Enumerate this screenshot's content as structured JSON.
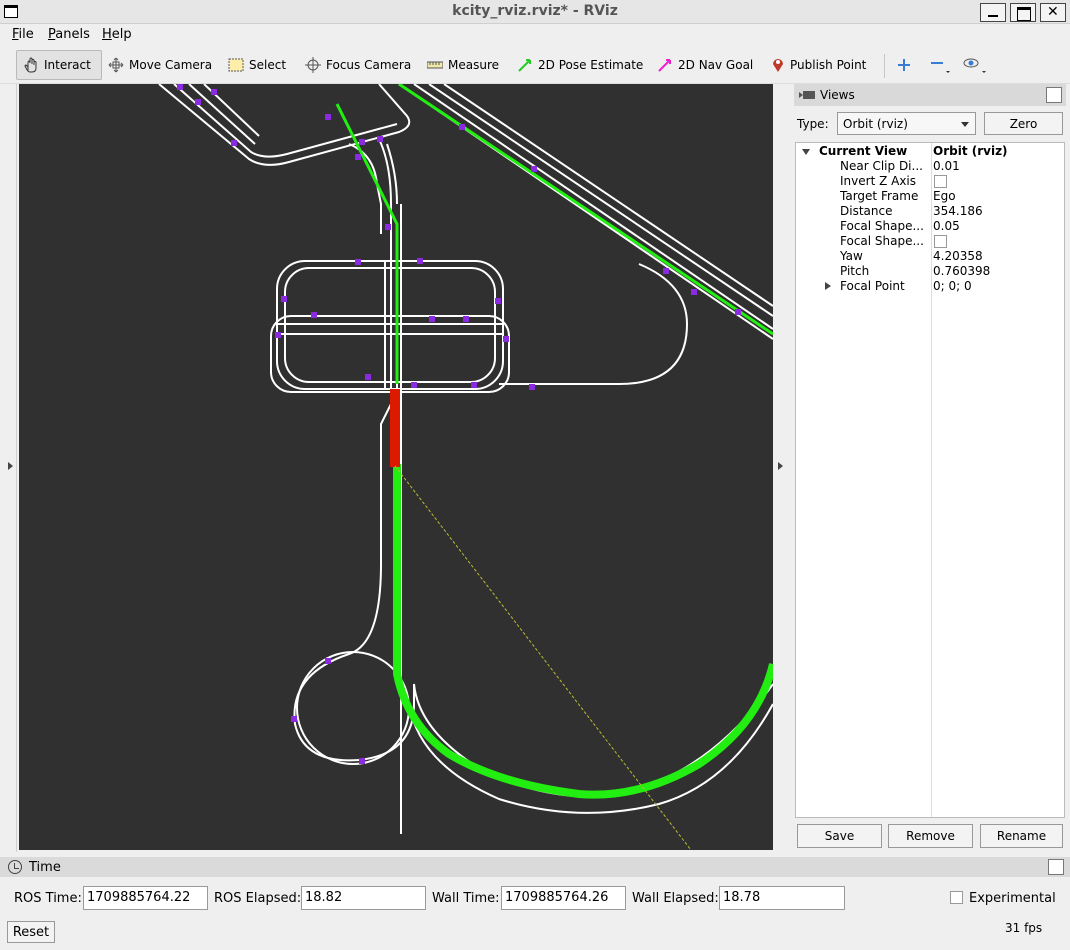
{
  "window": {
    "title": "kcity_rviz.rviz* - RViz"
  },
  "menu": {
    "file": "File",
    "panels": "Panels",
    "help": "Help"
  },
  "toolbar": {
    "interact": "Interact",
    "move_camera": "Move Camera",
    "select": "Select",
    "focus_camera": "Focus Camera",
    "measure": "Measure",
    "pose_estimate": "2D Pose Estimate",
    "nav_goal": "2D Nav Goal",
    "publish_point": "Publish Point"
  },
  "views": {
    "title": "Views",
    "type_label": "Type:",
    "type_value": "Orbit (rviz)",
    "zero": "Zero",
    "current_view": {
      "label": "Current View",
      "value": "Orbit (rviz)"
    },
    "properties": [
      {
        "key": "Near Clip Di...",
        "value": "0.01"
      },
      {
        "key": "Invert Z Axis",
        "value": ""
      },
      {
        "key": "Target Frame",
        "value": "Ego"
      },
      {
        "key": "Distance",
        "value": "354.186"
      },
      {
        "key": "Focal Shape...",
        "value": "0.05"
      },
      {
        "key": "Focal Shape...",
        "value": ""
      },
      {
        "key": "Yaw",
        "value": "4.20358"
      },
      {
        "key": "Pitch",
        "value": "0.760398"
      },
      {
        "key": "Focal Point",
        "value": "0; 0; 0"
      }
    ],
    "save": "Save",
    "remove": "Remove",
    "rename": "Rename"
  },
  "time": {
    "title": "Time",
    "ros_time_label": "ROS Time:",
    "ros_time": "1709885764.22",
    "ros_elapsed_label": "ROS Elapsed:",
    "ros_elapsed": "18.82",
    "wall_time_label": "Wall Time:",
    "wall_time": "1709885764.26",
    "wall_elapsed_label": "Wall Elapsed:",
    "wall_elapsed": "18.78",
    "experimental": "Experimental",
    "reset": "Reset",
    "fps": "31 fps"
  },
  "colors": {
    "background": "#303030",
    "lane": "#ffffff",
    "path": "#22ee11",
    "marker": "#8a2be2",
    "ego": "#dd1a00"
  }
}
